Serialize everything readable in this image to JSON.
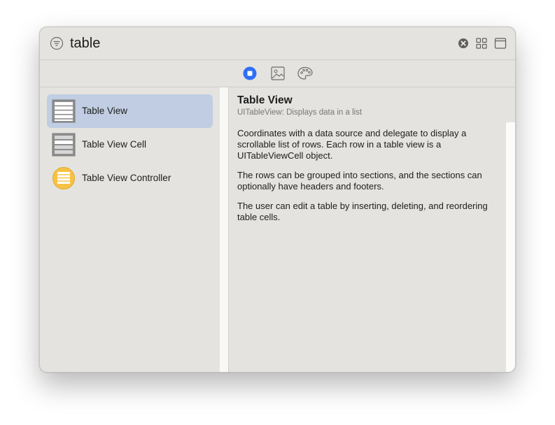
{
  "search": {
    "query": "table"
  },
  "toolbar": {
    "filter_icon": "filter-icon",
    "clear_icon": "clear-icon",
    "grid_icon": "grid-view-icon",
    "window_icon": "window-icon"
  },
  "tabs": [
    {
      "icon": "objects-icon",
      "selected": true
    },
    {
      "icon": "image-icon",
      "selected": false
    },
    {
      "icon": "palette-icon",
      "selected": false
    }
  ],
  "library": {
    "items": [
      {
        "label": "Table View",
        "icon": "table-view-icon",
        "selected": true
      },
      {
        "label": "Table View Cell",
        "icon": "table-view-cell-icon",
        "selected": false
      },
      {
        "label": "Table View Controller",
        "icon": "table-view-controller-icon",
        "selected": false
      }
    ]
  },
  "detail": {
    "title": "Table View",
    "subtitle": "UITableView: Displays data in a list",
    "paragraphs": [
      "Coordinates with a data source and delegate to display a scrollable list of rows. Each row in a table view is a UITableViewCell object.",
      "The rows can be grouped into sections, and the sections can optionally have headers and footers.",
      "The user can edit a table by inserting, deleting, and reordering table cells."
    ]
  },
  "colors": {
    "accent": "#2f6ef6",
    "selection": "#c0cde2",
    "window_bg": "#e4e3df",
    "controller_yellow": "#f7c244"
  }
}
